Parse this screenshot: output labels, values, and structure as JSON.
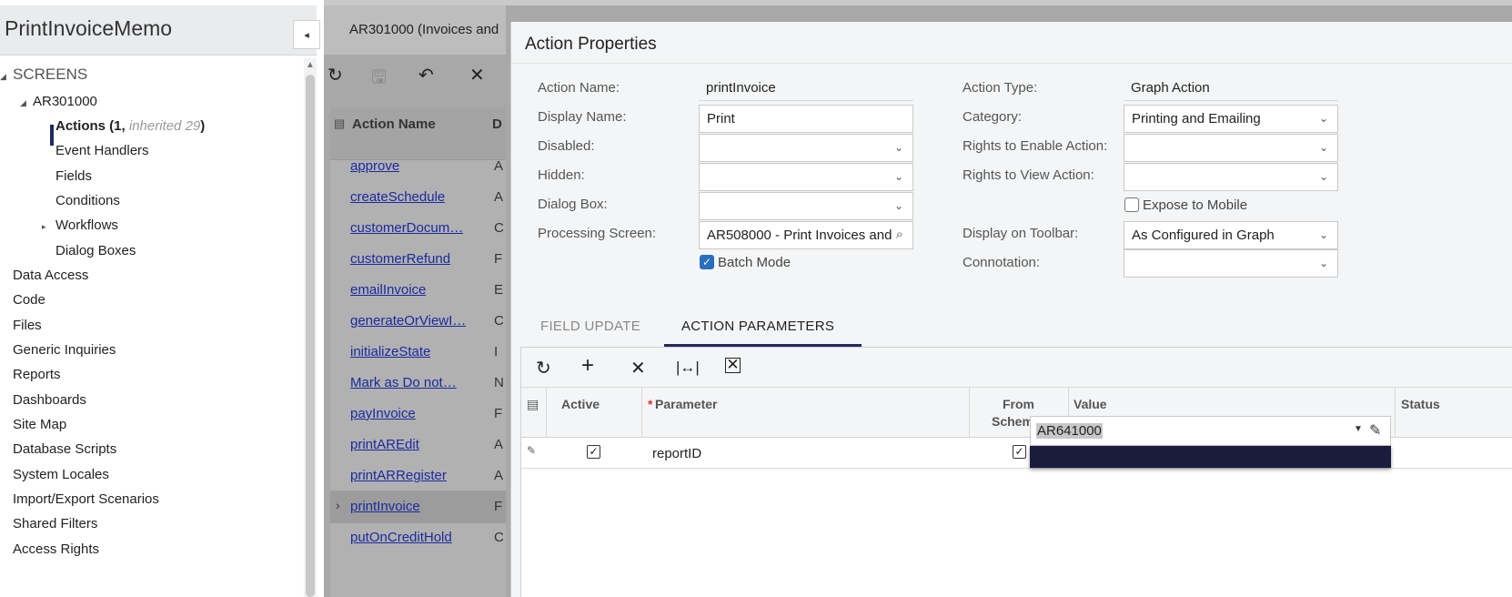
{
  "project": {
    "title": "PrintInvoiceMemo",
    "collapse_icon": "◂"
  },
  "tree": {
    "screens_label": "SCREENS",
    "screen_id": "AR301000",
    "actions_label": "Actions (1, ",
    "actions_inherited": "inherited 29",
    "actions_close": ")",
    "event_handlers": "Event Handlers",
    "fields": "Fields",
    "conditions": "Conditions",
    "workflows": "Workflows",
    "dialog_boxes": "Dialog Boxes",
    "top_items": [
      "Data Access",
      "Code",
      "Files",
      "Generic Inquiries",
      "Reports",
      "Dashboards",
      "Site Map",
      "Database Scripts",
      "System Locales",
      "Import/Export Scenarios",
      "Shared Filters",
      "Access Rights"
    ]
  },
  "background": {
    "tab_label": "AR301000 (Invoices and",
    "grid_header_action": "Action Name",
    "grid_header_d": "D",
    "rows": [
      {
        "name": "approve",
        "col2": "A"
      },
      {
        "name": "createSchedule",
        "col2": "A"
      },
      {
        "name": "customerDocum…",
        "col2": "C"
      },
      {
        "name": "customerRefund",
        "col2": "F"
      },
      {
        "name": "emailInvoice",
        "col2": "E"
      },
      {
        "name": "generateOrViewI…",
        "col2": "C"
      },
      {
        "name": "initializeState",
        "col2": "I"
      },
      {
        "name": "Mark as Do not…",
        "col2": "N"
      },
      {
        "name": "payInvoice",
        "col2": "F"
      },
      {
        "name": "printAREdit",
        "col2": "A"
      },
      {
        "name": "printARRegister",
        "col2": "A"
      },
      {
        "name": "printInvoice",
        "col2": "F"
      },
      {
        "name": "putOnCreditHold",
        "col2": "C"
      }
    ]
  },
  "dialog": {
    "title": "Action Properties",
    "left_fields": {
      "action_name_label": "Action Name:",
      "action_name_value": "printInvoice",
      "display_name_label": "Display Name:",
      "display_name_value": "Print",
      "disabled_label": "Disabled:",
      "hidden_label": "Hidden:",
      "dialog_box_label": "Dialog Box:",
      "processing_screen_label": "Processing Screen:",
      "processing_screen_value": "AR508000 - Print Invoices and",
      "batch_mode_label": "Batch Mode"
    },
    "right_fields": {
      "action_type_label": "Action Type:",
      "action_type_value": "Graph Action",
      "category_label": "Category:",
      "category_value": "Printing and Emailing",
      "rights_enable_label": "Rights to Enable Action:",
      "rights_view_label": "Rights to View Action:",
      "expose_mobile_label": "Expose to Mobile",
      "display_toolbar_label": "Display on Toolbar:",
      "display_toolbar_value": "As Configured in Graph",
      "connotation_label": "Connotation:"
    },
    "tabs": [
      "FIELD UPDATE",
      "ACTION PARAMETERS"
    ],
    "grid": {
      "headers": {
        "active": "Active",
        "required_mark": "*",
        "parameter": "Parameter",
        "from_schema_1": "From",
        "from_schema_2": "Schema",
        "value": "Value",
        "status": "Status"
      },
      "row": {
        "parameter": "reportID",
        "value": "AR641000"
      }
    }
  }
}
